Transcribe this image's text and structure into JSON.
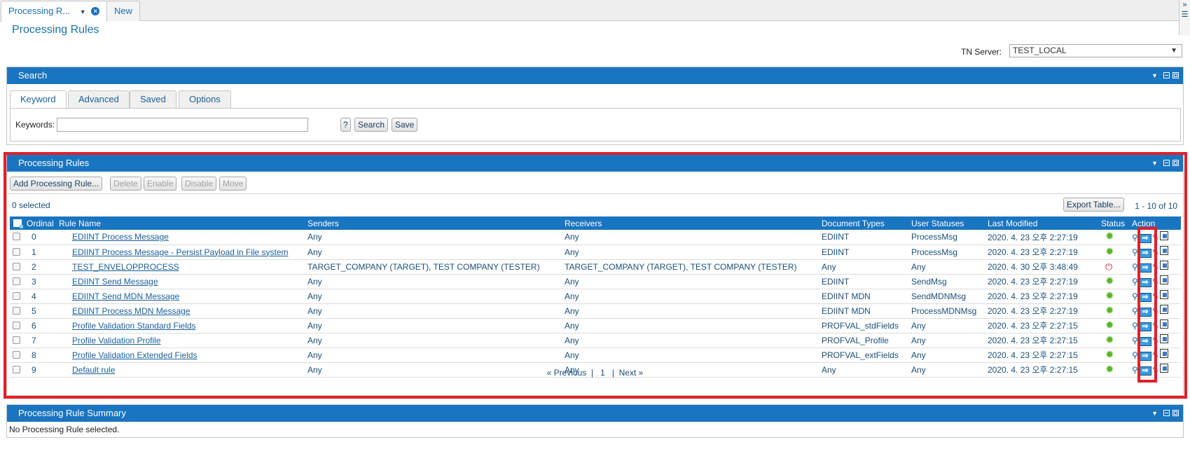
{
  "window_tabs": [
    {
      "label": "Processing R..."
    },
    {
      "label": "New"
    }
  ],
  "page_title": "Processing Rules",
  "tn_server": {
    "label": "TN Server:",
    "value": "TEST_LOCAL"
  },
  "search_panel": {
    "title": "Search",
    "tabs": [
      "Keyword",
      "Advanced",
      "Saved",
      "Options"
    ],
    "keywords_label": "Keywords:",
    "help_label": "?",
    "search_label": "Search",
    "save_label": "Save"
  },
  "rules_panel": {
    "title": "Processing Rules",
    "toolbar": {
      "add": "Add Processing Rule...",
      "delete": "Delete",
      "enable": "Enable",
      "disable": "Disable",
      "move": "Move"
    },
    "selected_count": "0 selected",
    "export_label": "Export Table...",
    "range_text": "1 - 10 of 10",
    "columns": [
      "Ordinal",
      "Rule Name",
      "Senders",
      "Receivers",
      "Document Types",
      "User Statuses",
      "Last Modified",
      "Status",
      "Action"
    ],
    "rows": [
      {
        "ordinal": "0",
        "name": "EDIINT Process Message",
        "senders": "Any",
        "receivers": "Any",
        "doctypes": "EDIINT",
        "statuses": "ProcessMsg",
        "modified": "2020. 4. 23 오후 2:27:19",
        "status": "enabled"
      },
      {
        "ordinal": "1",
        "name": "EDIINT Process Message - Persist Payload in File system",
        "senders": "Any",
        "receivers": "Any",
        "doctypes": "EDIINT",
        "statuses": "ProcessMsg",
        "modified": "2020. 4. 23 오후 2:27:19",
        "status": "enabled"
      },
      {
        "ordinal": "2",
        "name": "TEST_ENVELOPPROCESS",
        "senders": "TARGET_COMPANY (TARGET), TEST COMPANY (TESTER)",
        "receivers": "TARGET_COMPANY (TARGET), TEST COMPANY (TESTER)",
        "doctypes": "Any",
        "statuses": "Any",
        "modified": "2020. 4. 30 오후 3:48:49",
        "status": "disabled"
      },
      {
        "ordinal": "3",
        "name": "EDIINT Send Message",
        "senders": "Any",
        "receivers": "Any",
        "doctypes": "EDIINT",
        "statuses": "SendMsg",
        "modified": "2020. 4. 23 오후 2:27:19",
        "status": "enabled"
      },
      {
        "ordinal": "4",
        "name": "EDIINT Send MDN Message",
        "senders": "Any",
        "receivers": "Any",
        "doctypes": "EDIINT MDN",
        "statuses": "SendMDNMsg",
        "modified": "2020. 4. 23 오후 2:27:19",
        "status": "enabled"
      },
      {
        "ordinal": "5",
        "name": "EDIINT Process MDN Message",
        "senders": "Any",
        "receivers": "Any",
        "doctypes": "EDIINT MDN",
        "statuses": "ProcessMDNMsg",
        "modified": "2020. 4. 23 오후 2:27:19",
        "status": "enabled"
      },
      {
        "ordinal": "6",
        "name": "Profile Validation Standard Fields",
        "senders": "Any",
        "receivers": "Any",
        "doctypes": "PROFVAL_stdFields",
        "statuses": "Any",
        "modified": "2020. 4. 23 오후 2:27:15",
        "status": "enabled"
      },
      {
        "ordinal": "7",
        "name": "Profile Validation Profile",
        "senders": "Any",
        "receivers": "Any",
        "doctypes": "PROFVAL_Profile",
        "statuses": "Any",
        "modified": "2020. 4. 23 오후 2:27:15",
        "status": "enabled"
      },
      {
        "ordinal": "8",
        "name": "Profile Validation Extended Fields",
        "senders": "Any",
        "receivers": "Any",
        "doctypes": "PROFVAL_extFields",
        "statuses": "Any",
        "modified": "2020. 4. 23 오후 2:27:15",
        "status": "enabled"
      },
      {
        "ordinal": "9",
        "name": "Default rule",
        "senders": "Any",
        "receivers": "Any",
        "doctypes": "Any",
        "statuses": "Any",
        "modified": "2020. 4. 23 오후 2:27:15",
        "status": "enabled"
      }
    ],
    "pager": {
      "prev": "« Previous",
      "page": "1",
      "next": "Next »"
    }
  },
  "summary_panel": {
    "title": "Processing Rule Summary",
    "empty_text": "No Processing Rule selected."
  },
  "colors": {
    "header_blue": "#1a75c0",
    "highlight_red": "#e0202a",
    "enabled_green": "#55b824",
    "disabled_red": "#d42020"
  }
}
